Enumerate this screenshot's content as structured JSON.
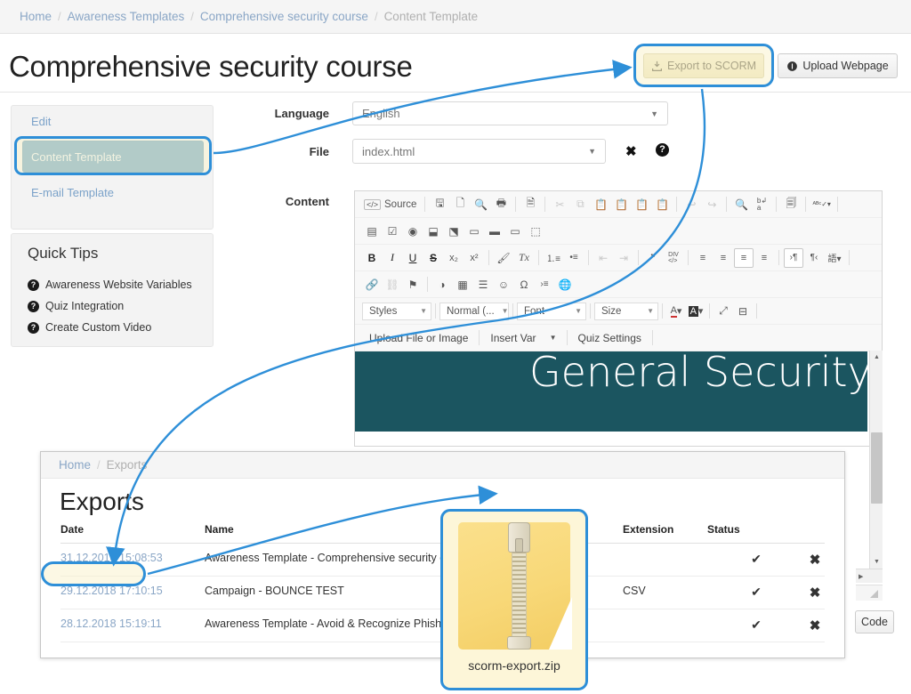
{
  "breadcrumb": {
    "items": [
      "Home",
      "Awareness Templates",
      "Comprehensive security course",
      "Content Template"
    ],
    "separator": "/"
  },
  "page": {
    "title": "Comprehensive security course"
  },
  "actions": {
    "export_scorm": "Export to SCORM",
    "upload_webpage": "Upload Webpage"
  },
  "sidebar": {
    "nav": [
      {
        "label": "Edit",
        "active": false
      },
      {
        "label": "Content Template",
        "active": true
      },
      {
        "label": "E-mail Template",
        "active": false
      }
    ],
    "tips_title": "Quick Tips",
    "tips": [
      "Awareness Website Variables",
      "Quiz Integration",
      "Create Custom Video"
    ]
  },
  "form": {
    "language_label": "Language",
    "language_value": "English",
    "file_label": "File",
    "file_value": "index.html",
    "content_label": "Content",
    "clear_icon": "close-icon",
    "help_icon": "help-icon"
  },
  "editor": {
    "toolbar_row1": [
      {
        "t": "text",
        "label": "Source",
        "icon": "source-icon"
      },
      {
        "t": "sep"
      },
      {
        "t": "icon",
        "label": "💾",
        "name": "save-icon"
      },
      {
        "t": "icon",
        "label": "🗋",
        "name": "new-page-icon"
      },
      {
        "t": "icon",
        "label": "🔍",
        "name": "preview-icon"
      },
      {
        "t": "icon",
        "label": "🖶",
        "name": "print-icon"
      },
      {
        "t": "sep"
      },
      {
        "t": "icon",
        "label": "🗎",
        "name": "templates-icon"
      },
      {
        "t": "sep"
      },
      {
        "t": "icon",
        "label": "✂",
        "name": "cut-icon",
        "dim": true
      },
      {
        "t": "icon",
        "label": "⧉",
        "name": "copy-icon",
        "dim": true
      },
      {
        "t": "icon",
        "label": "📋",
        "name": "paste-icon"
      },
      {
        "t": "icon",
        "label": "📋",
        "name": "paste-text-icon"
      },
      {
        "t": "icon",
        "label": "📋",
        "name": "paste-word-icon"
      },
      {
        "t": "sep"
      },
      {
        "t": "icon",
        "label": "↶",
        "name": "undo-icon",
        "dim": true
      },
      {
        "t": "icon",
        "label": "↷",
        "name": "redo-icon",
        "dim": true
      },
      {
        "t": "sep"
      },
      {
        "t": "icon",
        "label": "🔍",
        "name": "find-icon"
      },
      {
        "t": "icon",
        "label": "ᵇ⇄ₐ",
        "name": "replace-icon"
      },
      {
        "t": "sep"
      },
      {
        "t": "icon",
        "label": "☰",
        "name": "select-all-icon"
      },
      {
        "t": "sep"
      },
      {
        "t": "icon",
        "label": "ABC✓",
        "name": "spellcheck-icon",
        "caret": true
      },
      {
        "t": "sep"
      }
    ],
    "toolbar_row2": [
      {
        "t": "icon",
        "label": "▤",
        "name": "form-icon"
      },
      {
        "t": "icon",
        "label": "☑",
        "name": "checkbox-icon"
      },
      {
        "t": "icon",
        "label": "◉",
        "name": "radio-icon"
      },
      {
        "t": "icon",
        "label": "⬓",
        "name": "text-field-icon"
      },
      {
        "t": "icon",
        "label": "⬔",
        "name": "textarea-icon"
      },
      {
        "t": "icon",
        "label": "▭",
        "name": "select-field-icon"
      },
      {
        "t": "icon",
        "label": "▬",
        "name": "button-icon"
      },
      {
        "t": "icon",
        "label": "▭",
        "name": "image-button-icon"
      },
      {
        "t": "icon",
        "label": "⬚",
        "name": "hidden-field-icon"
      }
    ],
    "toolbar_row3": [
      {
        "t": "icon",
        "label": "B",
        "name": "bold-icon",
        "bold": true
      },
      {
        "t": "icon",
        "label": "I",
        "name": "italic-icon",
        "italic": true
      },
      {
        "t": "icon",
        "label": "U",
        "name": "underline-icon",
        "underline": true
      },
      {
        "t": "icon",
        "label": "S",
        "name": "strike-icon"
      },
      {
        "t": "icon",
        "label": "x₂",
        "name": "subscript-icon"
      },
      {
        "t": "icon",
        "label": "x²",
        "name": "superscript-icon"
      },
      {
        "t": "sep"
      },
      {
        "t": "icon",
        "label": "🖌",
        "name": "copy-formatting-icon"
      },
      {
        "t": "icon",
        "label": "Tx",
        "name": "remove-format-icon"
      },
      {
        "t": "sep"
      },
      {
        "t": "icon",
        "label": "⒈☰",
        "name": "numbered-list-icon"
      },
      {
        "t": "icon",
        "label": "•☰",
        "name": "bulleted-list-icon"
      },
      {
        "t": "sep"
      },
      {
        "t": "icon",
        "label": "⇤",
        "name": "outdent-icon",
        "dim": true
      },
      {
        "t": "icon",
        "label": "⇥",
        "name": "indent-icon",
        "dim": true
      },
      {
        "t": "sep"
      },
      {
        "t": "icon",
        "label": "❞",
        "name": "blockquote-icon"
      },
      {
        "t": "icon",
        "label": "DIV",
        "name": "create-div-icon"
      },
      {
        "t": "sep"
      },
      {
        "t": "icon",
        "label": "≡",
        "name": "align-left-icon"
      },
      {
        "t": "icon",
        "label": "≡",
        "name": "align-center-icon"
      },
      {
        "t": "icon",
        "label": "≡",
        "name": "align-right-icon",
        "framed": true
      },
      {
        "t": "icon",
        "label": "≡",
        "name": "align-justify-icon"
      },
      {
        "t": "sep"
      },
      {
        "t": "icon",
        "label": "¶",
        "name": "ltr-icon",
        "framed": true
      },
      {
        "t": "icon",
        "label": "¶",
        "name": "rtl-icon"
      },
      {
        "t": "icon",
        "label": "語",
        "name": "language-icon",
        "caret": true
      },
      {
        "t": "sep"
      }
    ],
    "toolbar_row4": [
      {
        "t": "icon",
        "label": "🔗",
        "name": "link-icon"
      },
      {
        "t": "icon",
        "label": "⛓",
        "name": "unlink-icon",
        "dim": true
      },
      {
        "t": "icon",
        "label": "⚑",
        "name": "anchor-icon"
      },
      {
        "t": "sep"
      },
      {
        "t": "icon",
        "label": "◑",
        "name": "image-icon"
      },
      {
        "t": "icon",
        "label": "▦",
        "name": "table-icon"
      },
      {
        "t": "icon",
        "label": "▬",
        "name": "horizontal-rule-icon"
      },
      {
        "t": "icon",
        "label": "☺",
        "name": "smiley-icon"
      },
      {
        "t": "icon",
        "label": "Ω",
        "name": "special-char-icon"
      },
      {
        "t": "icon",
        "label": "⇥≡",
        "name": "page-break-icon"
      },
      {
        "t": "icon",
        "label": "🌐",
        "name": "iframe-icon"
      }
    ],
    "combos": [
      {
        "label": "Styles",
        "name": "styles-combo"
      },
      {
        "label": "Normal (...",
        "name": "format-combo"
      },
      {
        "label": "Font",
        "name": "font-combo"
      },
      {
        "label": "Size",
        "name": "size-combo"
      }
    ],
    "color_tools": [
      {
        "label": "A",
        "name": "text-color-icon"
      },
      {
        "label": "A",
        "name": "background-color-icon"
      },
      {
        "label": "⤢",
        "name": "maximize-icon"
      },
      {
        "label": "⊟",
        "name": "show-blocks-icon"
      }
    ],
    "custom_buttons": [
      "Upload File or Image",
      "Insert Var",
      "Quiz Settings"
    ],
    "canvas_heading": "General Security Awareness Course",
    "code_button": "Code",
    "canvas_bg": "#1b5560"
  },
  "exports_window": {
    "breadcrumb": [
      "Home",
      "Exports"
    ],
    "title": "Exports",
    "columns": [
      "Date",
      "Name",
      "Extension",
      "Status",
      ""
    ],
    "rows": [
      {
        "date": "31.12.2018 15:08:53",
        "name": "Awareness Template - Comprehensive security course",
        "extension": "",
        "status": "✔",
        "delete": "✖",
        "highlighted": true
      },
      {
        "date": "29.12.2018 17:10:15",
        "name": "Campaign - BOUNCE TEST",
        "extension": "CSV",
        "status": "✔",
        "delete": "✖",
        "highlighted": false
      },
      {
        "date": "28.12.2018 15:19:11",
        "name": "Awareness Template - Avoid & Recognize Phishing Attacks (V 2.3)",
        "extension": "",
        "status": "✔",
        "delete": "✖",
        "highlighted": false
      }
    ]
  },
  "zip_callout": {
    "filename": "scorm-export.zip",
    "icon": "zip-archive-icon"
  },
  "annotation": {
    "color": "#2e8fd8",
    "highlight_fill": "#faf3cd"
  }
}
